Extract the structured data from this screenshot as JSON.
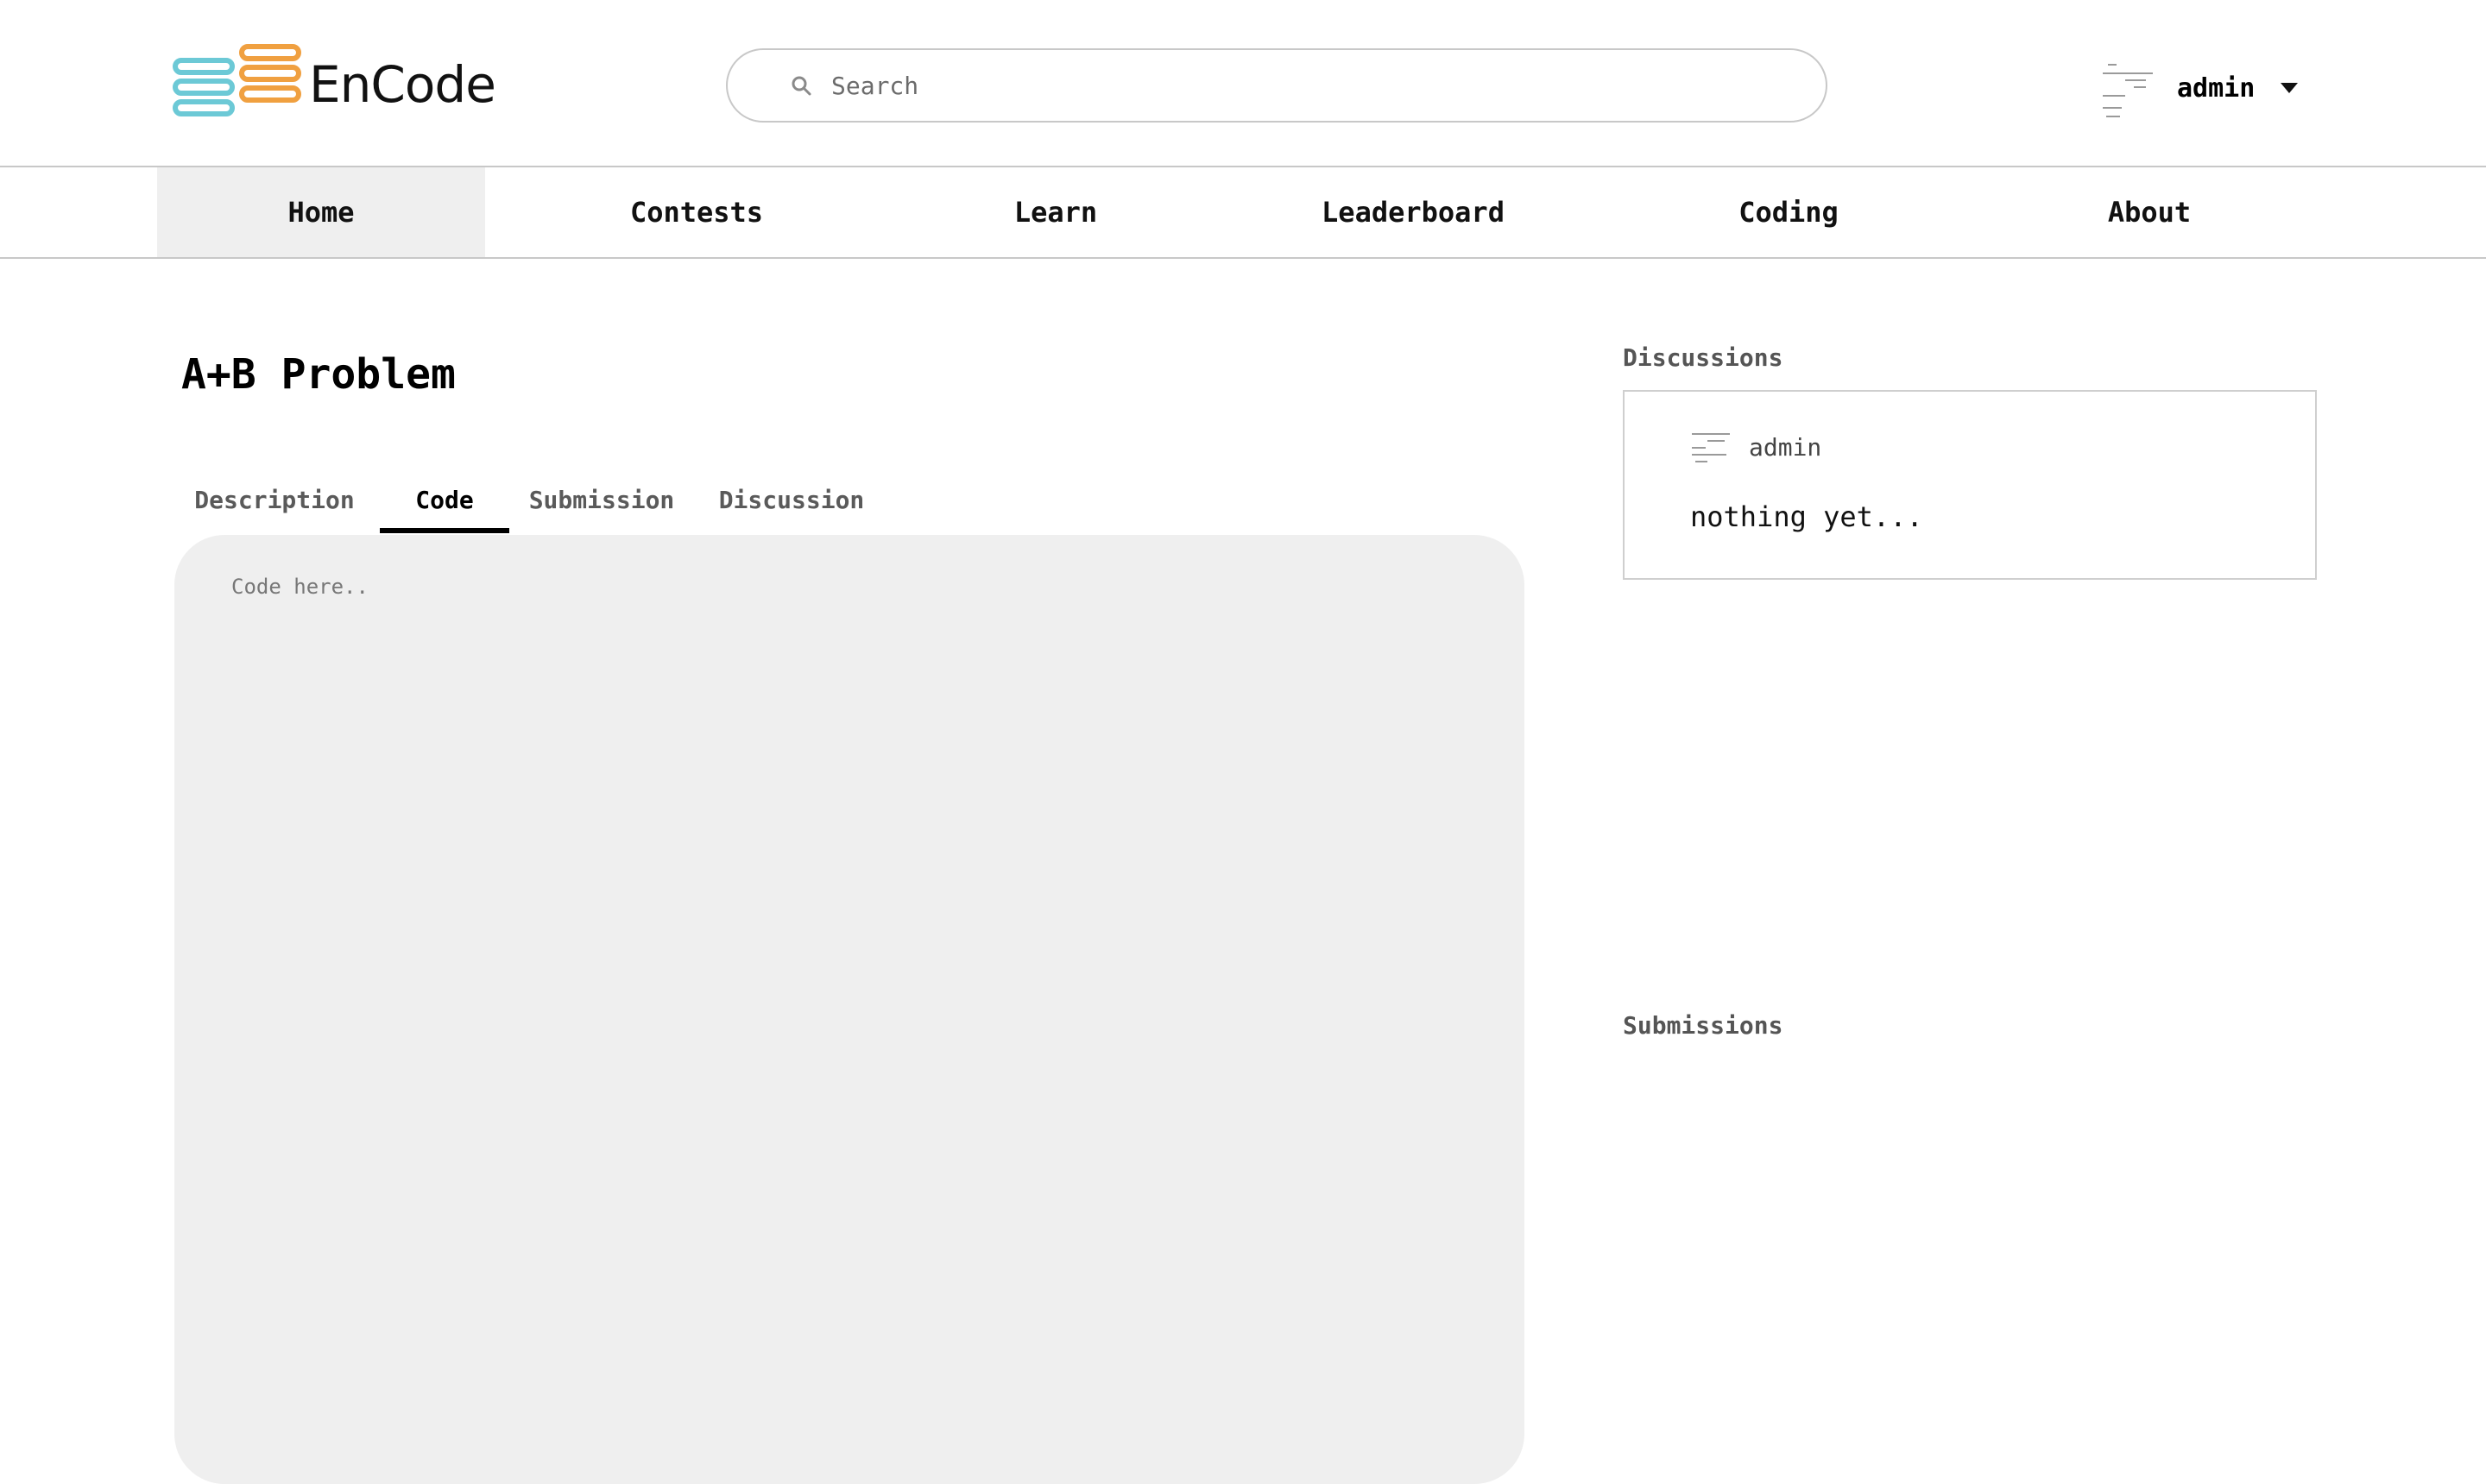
{
  "header": {
    "logo_text": "EnCode",
    "search_placeholder": "Search",
    "user_name": "admin"
  },
  "nav": {
    "items": [
      {
        "label": "Home",
        "active": true
      },
      {
        "label": "Contests",
        "active": false
      },
      {
        "label": "Learn",
        "active": false
      },
      {
        "label": "Leaderboard",
        "active": false
      },
      {
        "label": "Coding",
        "active": false
      },
      {
        "label": "About",
        "active": false
      }
    ]
  },
  "problem": {
    "title": "A+B Problem",
    "tabs": [
      {
        "label": "Description",
        "active": false
      },
      {
        "label": "Code",
        "active": true
      },
      {
        "label": "Submission",
        "active": false
      },
      {
        "label": "Discussion",
        "active": false
      }
    ],
    "editor_placeholder": "Code here.."
  },
  "sidebar": {
    "discussions_label": "Discussions",
    "discussion": {
      "user": "admin",
      "text": "nothing yet..."
    },
    "submissions_label": "Submissions"
  },
  "icons": {
    "search": "search-icon",
    "caret": "chevron-down-icon",
    "logo": "encode-logo-icon"
  },
  "colors": {
    "logo_teal": "#6cc9d6",
    "logo_orange": "#f0a040",
    "active_nav_bg": "#efefef",
    "editor_bg": "#efefef"
  }
}
